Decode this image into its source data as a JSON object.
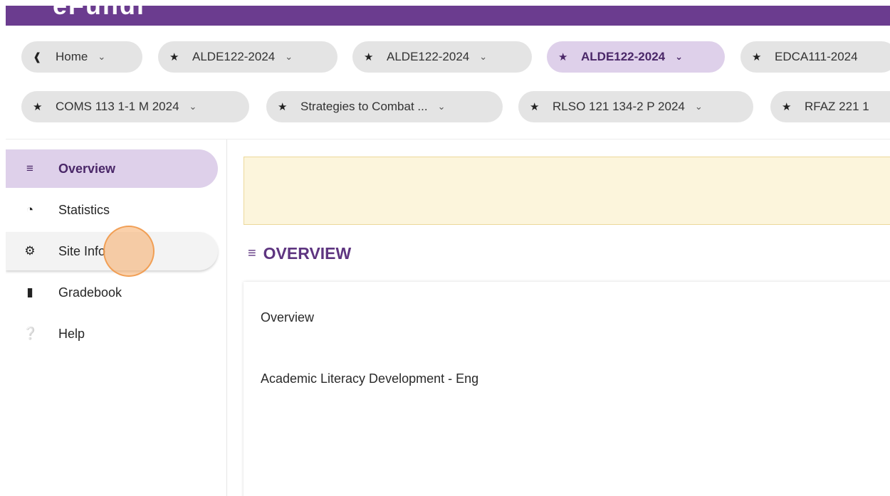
{
  "brand": {
    "logo_text": "eFundi"
  },
  "tabs_row1": [
    {
      "icon": "home-icon",
      "label": "Home",
      "active": false
    },
    {
      "icon": "star-icon",
      "label": "ALDE122-2024",
      "active": false
    },
    {
      "icon": "star-icon",
      "label": "ALDE122-2024",
      "active": false
    },
    {
      "icon": "star-icon",
      "label": "ALDE122-2024",
      "active": true
    },
    {
      "icon": "star-icon",
      "label": "EDCA111-2024",
      "active": false
    }
  ],
  "tabs_row2": [
    {
      "icon": "star-icon",
      "label": "COMS 113 1-1 M 2024",
      "active": false
    },
    {
      "icon": "star-icon",
      "label": "Strategies to Combat ...",
      "active": false
    },
    {
      "icon": "star-icon",
      "label": "RLSO 121 134-2 P 2024",
      "active": false
    },
    {
      "icon": "star-icon",
      "label": "RFAZ 221 1",
      "active": false
    }
  ],
  "sidebar": {
    "items": [
      {
        "icon": "list-icon",
        "label": "Overview",
        "active": true
      },
      {
        "icon": "pie-chart-icon",
        "label": "Statistics",
        "active": false
      },
      {
        "icon": "gear-icon",
        "label": "Site Info",
        "active": false,
        "hover": true
      },
      {
        "icon": "book-icon",
        "label": "Gradebook",
        "active": false
      },
      {
        "icon": "help-icon",
        "label": "Help",
        "active": false
      }
    ]
  },
  "main": {
    "section_title": "OVERVIEW",
    "content_heading": "Overview",
    "content_body": "Academic Literacy Development - Eng"
  },
  "colors": {
    "brand_purple": "#6b3c8f",
    "active_bg": "#ded0ea",
    "alert_bg": "#fcf5dc",
    "click_marker": "#f6aa64"
  }
}
